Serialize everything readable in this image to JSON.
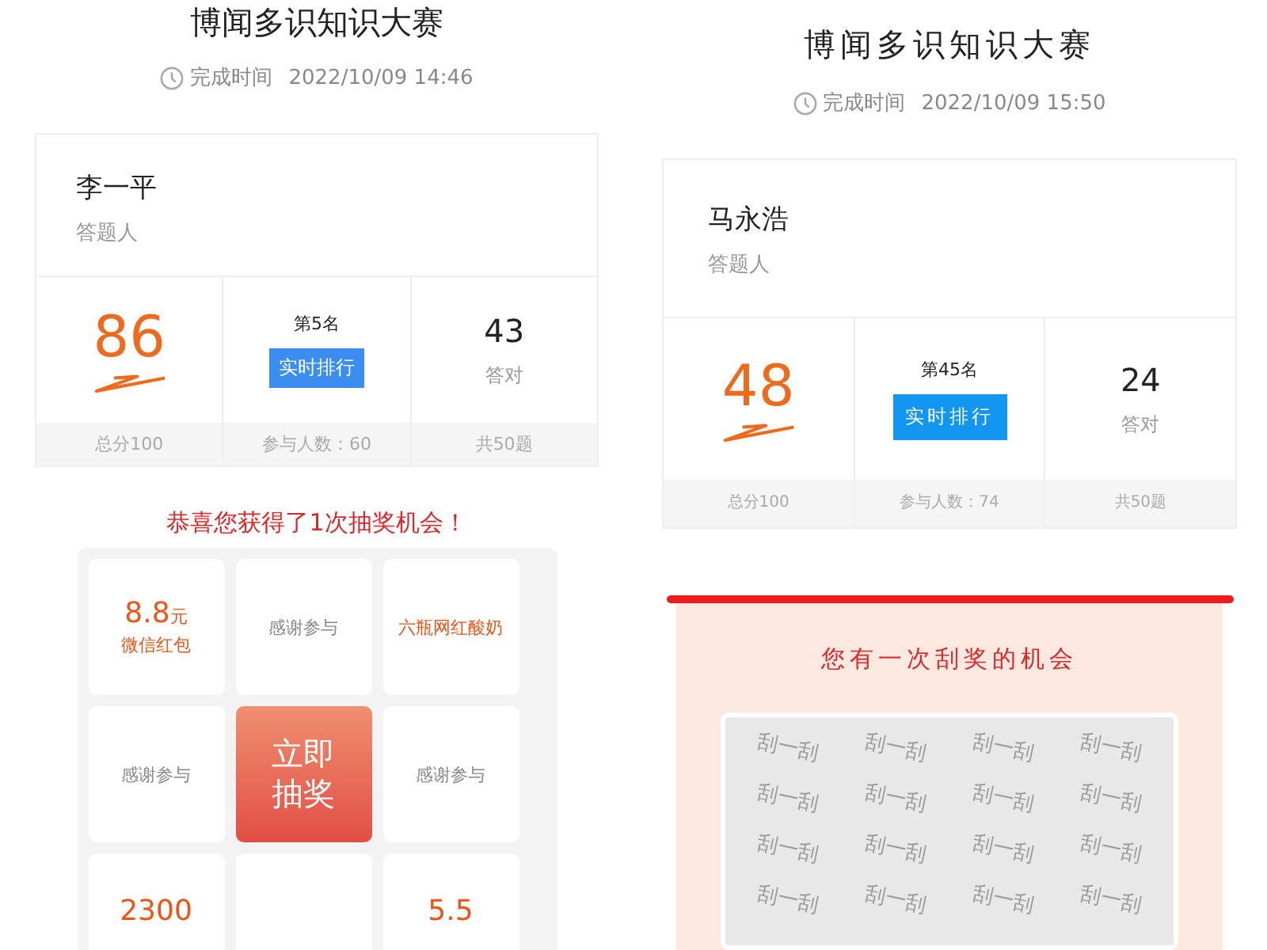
{
  "panels": [
    {
      "kind": "lottery",
      "title": "博闻多识知识大赛",
      "time_label": "完成时间",
      "time": "2022/10/09 14:46",
      "name": "李一平",
      "name_label": "答题人",
      "score": "86",
      "score_footer": "总分100",
      "rank": "第5名",
      "rank_button": "实时排行",
      "participants": "参与人数：60",
      "correct": "43",
      "correct_label": "答对",
      "total": "共50题",
      "lottery": {
        "heading": "恭喜您获得了1次抽奖机会！",
        "draw_button": "立即抽奖",
        "cells": [
          {
            "kind": "cash",
            "amount": "8.8",
            "unit": "元",
            "label": "微信红包"
          },
          {
            "kind": "thanks",
            "label": "感谢参与"
          },
          {
            "kind": "gift",
            "label": "六瓶网红酸奶"
          },
          {
            "kind": "thanks",
            "label": "感谢参与"
          },
          {
            "kind": "thanks",
            "label": "感谢参与"
          },
          {
            "kind": "cash",
            "amount": "2300"
          },
          {
            "kind": "thanks"
          },
          {
            "kind": "cash",
            "amount": "5.5"
          }
        ]
      }
    },
    {
      "kind": "scratch",
      "title": "博闻多识知识大赛",
      "time_label": "完成时间",
      "time": "2022/10/09 15:50",
      "name": "马永浩",
      "name_label": "答题人",
      "score": "48",
      "score_footer": "总分100",
      "rank": "第45名",
      "rank_button": "实时排行",
      "participants": "参与人数：74",
      "correct": "24",
      "correct_label": "答对",
      "total": "共50题",
      "scratch": {
        "heading": "您有一次刮奖的机会",
        "pattern": [
          "刮一刮",
          "刮一刮",
          "刮一刮",
          "刮一刮",
          "刮一刮",
          "刮一刮",
          "刮一刮",
          "刮一刮",
          "刮一刮",
          "刮一刮",
          "刮一刮",
          "刮一刮",
          "刮一刮",
          "刮一刮",
          "刮一刮",
          "刮一刮"
        ]
      }
    }
  ]
}
